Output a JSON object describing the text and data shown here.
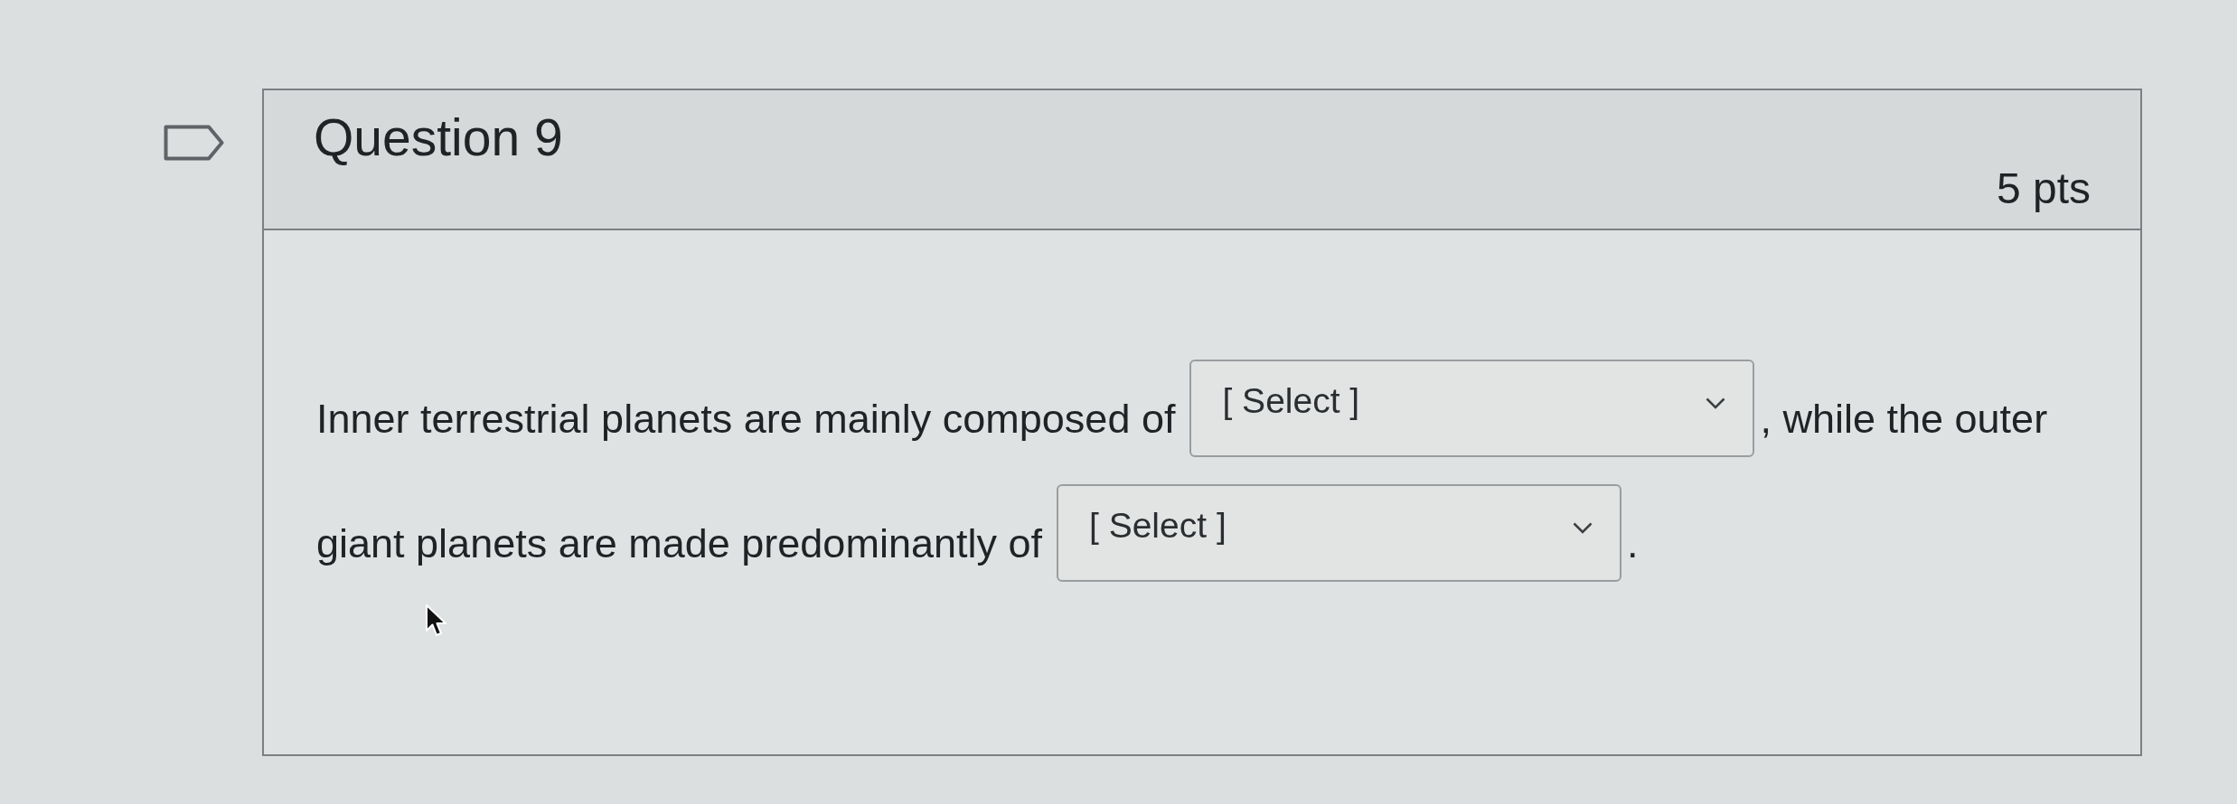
{
  "question": {
    "title": "Question 9",
    "points": "5 pts",
    "lines": [
      {
        "segments": [
          {
            "kind": "text",
            "text": "Inner terrestrial planets are mainly composed of"
          },
          {
            "kind": "select",
            "value": "[ Select ]"
          },
          {
            "kind": "text",
            "text": ", while the outer"
          }
        ]
      },
      {
        "segments": [
          {
            "kind": "text",
            "text": "giant planets are made predominantly of"
          },
          {
            "kind": "select",
            "value": "[ Select ]"
          },
          {
            "kind": "text",
            "text": "."
          }
        ]
      }
    ]
  }
}
